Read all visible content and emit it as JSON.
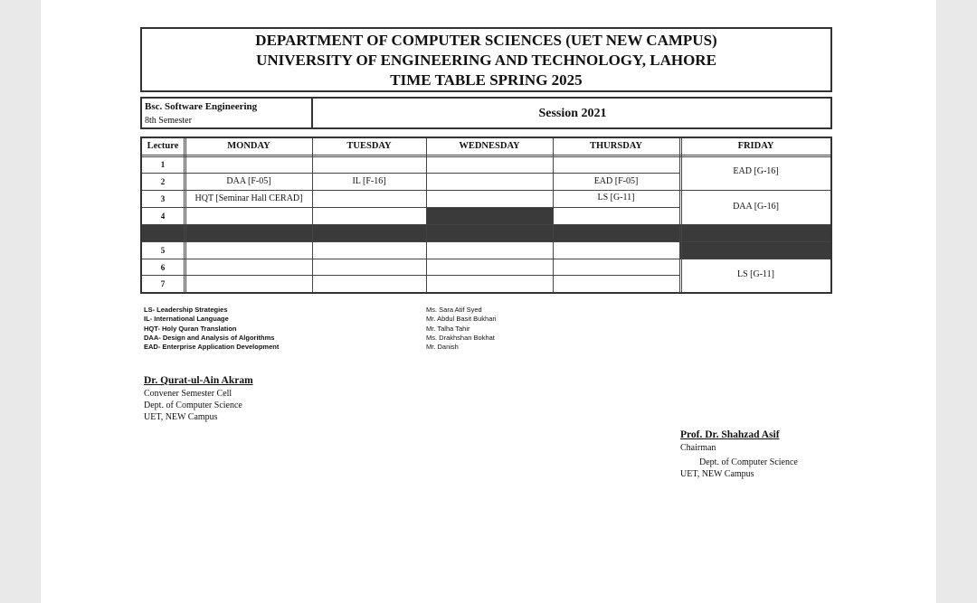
{
  "header": {
    "line1": "DEPARTMENT OF COMPUTER SCIENCES (UET NEW CAMPUS)",
    "line2": "UNIVERSITY OF ENGINEERING AND TECHNOLOGY, LAHORE",
    "line3": "TIME TABLE SPRING 2025"
  },
  "program": {
    "name": "Bsc. Software Engineering",
    "semester": "8th Semester",
    "session": "Session 2021"
  },
  "timetable": {
    "headers": [
      "Lecture",
      "MONDAY",
      "TUESDAY",
      "WEDNESDAY",
      "THURSDAY",
      "FRIDAY"
    ],
    "lectures": [
      "1",
      "2",
      "3",
      "4",
      "5",
      "6",
      "7"
    ],
    "entries": {
      "mon_l2": "DAA [F-05]",
      "mon_l3": "HQT [Seminar Hall CERAD]",
      "tue_l2": "IL [F-16]",
      "thu_l2": "EAD [F-05]",
      "thu_l3": "LS [G-11]",
      "fri_l12": "EAD [G-16]",
      "fri_l34": "DAA [G-16]",
      "fri_l67": "LS [G-11]"
    }
  },
  "legend": {
    "courses": [
      "LS- Leadership Strategies",
      "IL- International Language",
      "HQT- Holy Quran Translation",
      "DAA- Design and Analysis of Algorithms",
      "EAD- Enterprise Application Development"
    ],
    "teachers": [
      "Ms. Sara Atif Syed",
      "Mr. Abdul Basit Bukhari",
      "Mr. Talha Tahir",
      "Ms. Drakhshan Bokhat",
      "Mr. Danish"
    ]
  },
  "signatures": {
    "convener": {
      "name": "Dr. Qurat-ul-Ain Akram",
      "title": "Convener Semester Cell",
      "dept": "Dept. of Computer Science",
      "campus": "UET, NEW Campus"
    },
    "chairman": {
      "name": "Prof. Dr. Shahzad Asif",
      "title": "Chairman",
      "dept": "Dept. of Computer Science",
      "campus": "UET, NEW Campus"
    }
  }
}
